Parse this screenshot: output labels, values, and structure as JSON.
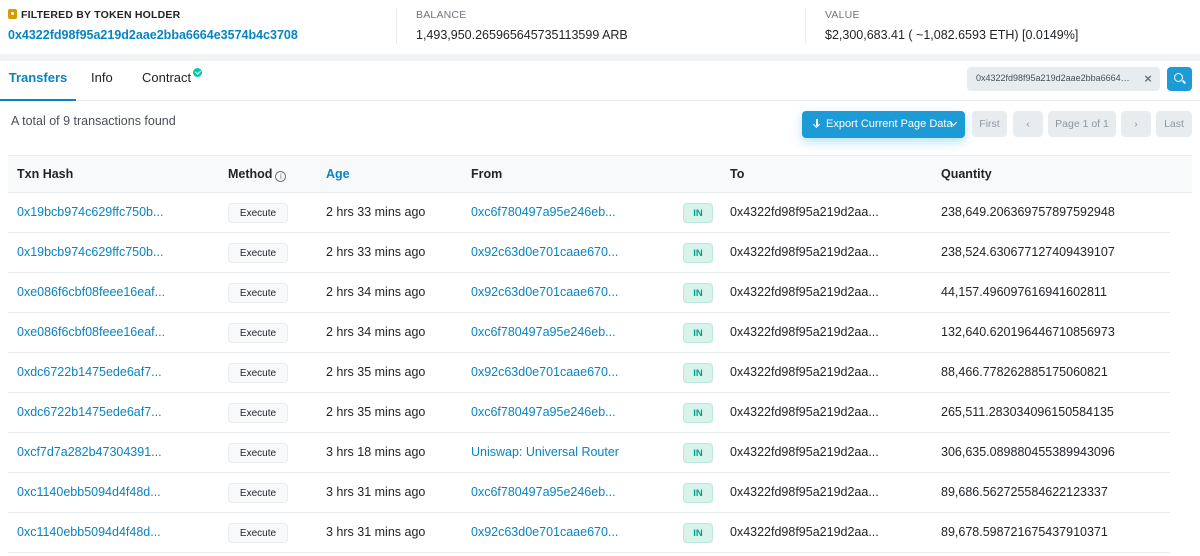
{
  "summary": {
    "holder_label": "FILTERED BY TOKEN HOLDER",
    "holder_address": "0x4322fd98f95a219d2aae2bba6664e3574b4c3708",
    "balance_label": "BALANCE",
    "balance_value": "1,493,950.265965645735113599 ARB",
    "value_label": "VALUE",
    "value_value": "$2,300,683.41 ( ~1,082.6593 ETH) [0.0149%]"
  },
  "tabs": [
    {
      "label": "Transfers",
      "active": true
    },
    {
      "label": "Info"
    },
    {
      "label": "Contract"
    }
  ],
  "filter": {
    "value": "0x4322fd98f95a219d2aae2bba6664e3574b4c3708",
    "close": "×"
  },
  "controls": {
    "total_text": "A total of 9 transactions found",
    "export_label": "Export Current Page Data",
    "first": "First",
    "prev": "‹",
    "page": "Page 1 of 1",
    "next": "›",
    "last": "Last"
  },
  "table": {
    "headers": {
      "hash": "Txn Hash",
      "method": "Method",
      "age": "Age",
      "from": "From",
      "to": "To",
      "quantity": "Quantity"
    },
    "rows": [
      {
        "hash": "0x19bcb974c629ffc750b...",
        "method": "Execute",
        "age": "2 hrs 33 mins ago",
        "from": "0xc6f780497a95e246eb...",
        "dir": "IN",
        "to": "0x4322fd98f95a219d2aa...",
        "quantity": "238,649.206369757897592948"
      },
      {
        "hash": "0x19bcb974c629ffc750b...",
        "method": "Execute",
        "age": "2 hrs 33 mins ago",
        "from": "0x92c63d0e701caae670...",
        "dir": "IN",
        "to": "0x4322fd98f95a219d2aa...",
        "quantity": "238,524.630677127409439107"
      },
      {
        "hash": "0xe086f6cbf08feee16eaf...",
        "method": "Execute",
        "age": "2 hrs 34 mins ago",
        "from": "0x92c63d0e701caae670...",
        "dir": "IN",
        "to": "0x4322fd98f95a219d2aa...",
        "quantity": "44,157.496097616941602811"
      },
      {
        "hash": "0xe086f6cbf08feee16eaf...",
        "method": "Execute",
        "age": "2 hrs 34 mins ago",
        "from": "0xc6f780497a95e246eb...",
        "dir": "IN",
        "to": "0x4322fd98f95a219d2aa...",
        "quantity": "132,640.620196446710856973"
      },
      {
        "hash": "0xdc6722b1475ede6af7...",
        "method": "Execute",
        "age": "2 hrs 35 mins ago",
        "from": "0x92c63d0e701caae670...",
        "dir": "IN",
        "to": "0x4322fd98f95a219d2aa...",
        "quantity": "88,466.778262885175060821"
      },
      {
        "hash": "0xdc6722b1475ede6af7...",
        "method": "Execute",
        "age": "2 hrs 35 mins ago",
        "from": "0xc6f780497a95e246eb...",
        "dir": "IN",
        "to": "0x4322fd98f95a219d2aa...",
        "quantity": "265,511.283034096150584135"
      },
      {
        "hash": "0xcf7d7a282b47304391...",
        "method": "Execute",
        "age": "3 hrs 18 mins ago",
        "from": "Uniswap: Universal Router",
        "dir": "IN",
        "to": "0x4322fd98f95a219d2aa...",
        "quantity": "306,635.089880455389943096"
      },
      {
        "hash": "0xc1140ebb5094d4f48d...",
        "method": "Execute",
        "age": "3 hrs 31 mins ago",
        "from": "0xc6f780497a95e246eb...",
        "dir": "IN",
        "to": "0x4322fd98f95a219d2aa...",
        "quantity": "89,686.562725584622123337"
      },
      {
        "hash": "0xc1140ebb5094d4f48d...",
        "method": "Execute",
        "age": "3 hrs 31 mins ago",
        "from": "0x92c63d0e701caae670...",
        "dir": "IN",
        "to": "0x4322fd98f95a219d2aa...",
        "quantity": "89,678.598721675437910371"
      }
    ]
  }
}
